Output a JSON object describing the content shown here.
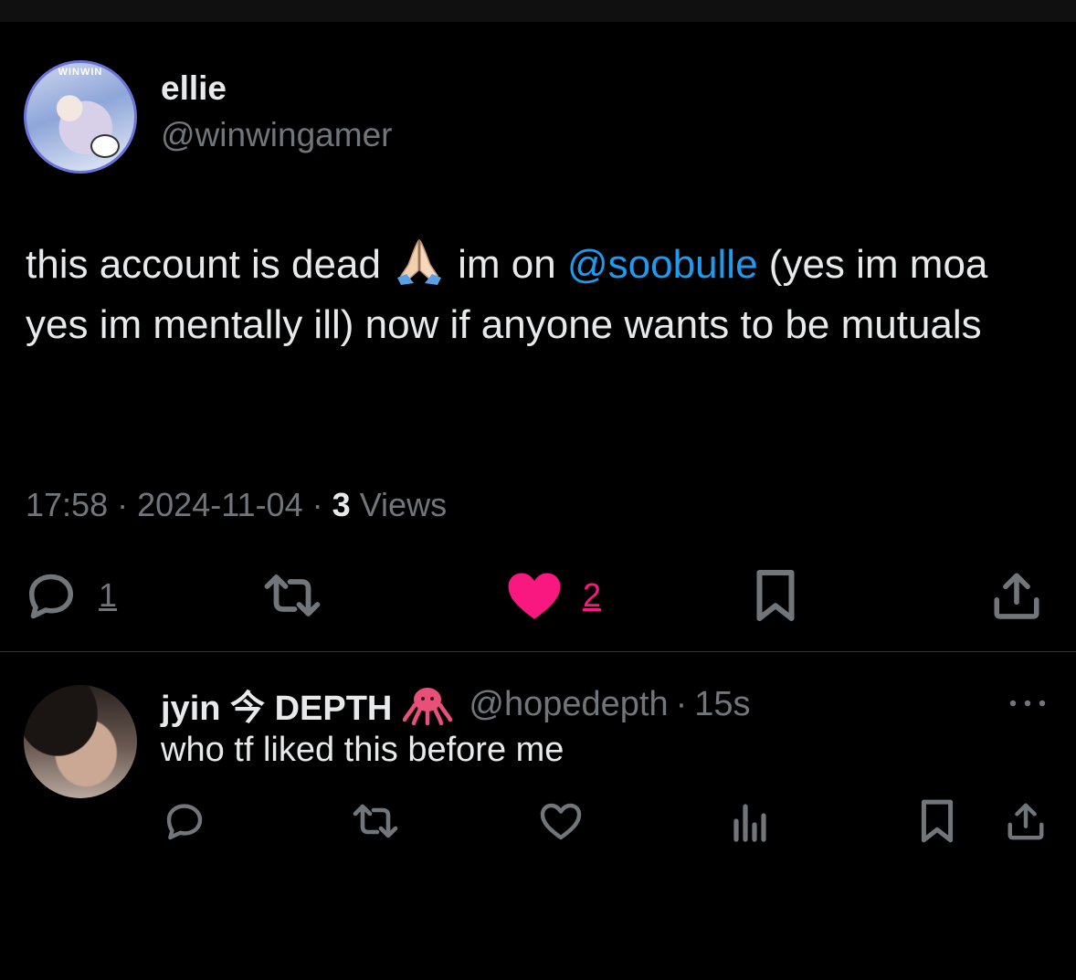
{
  "tweet": {
    "author": {
      "display_name": "ellie",
      "handle": "@winwingamer",
      "avatar_text": "WINWIN"
    },
    "text_part1": "this account is dead",
    "emoji": "folded-hands",
    "text_part2": "im on",
    "mention": "@soobulle",
    "text_part3": "(yes im moa yes im mentally ill)  now if anyone wants to be mutuals",
    "time": "17:58",
    "date": "2024-11-04",
    "separator": "·",
    "views_count": "3",
    "views_label": "Views",
    "actions": {
      "reply_count": "1",
      "like_count": "2",
      "liked": true
    }
  },
  "reply": {
    "author_name": "jyin 今 DEPTH",
    "author_emoji": "octopus",
    "handle": "@hopedepth",
    "separator": "·",
    "time": "15s",
    "text": "who tf liked this before me"
  },
  "colors": {
    "background": "#000000",
    "text": "#e7e9ea",
    "secondary": "#71767b",
    "mention": "#1d9bf0",
    "like": "#f91880",
    "divider": "#2f3336"
  }
}
